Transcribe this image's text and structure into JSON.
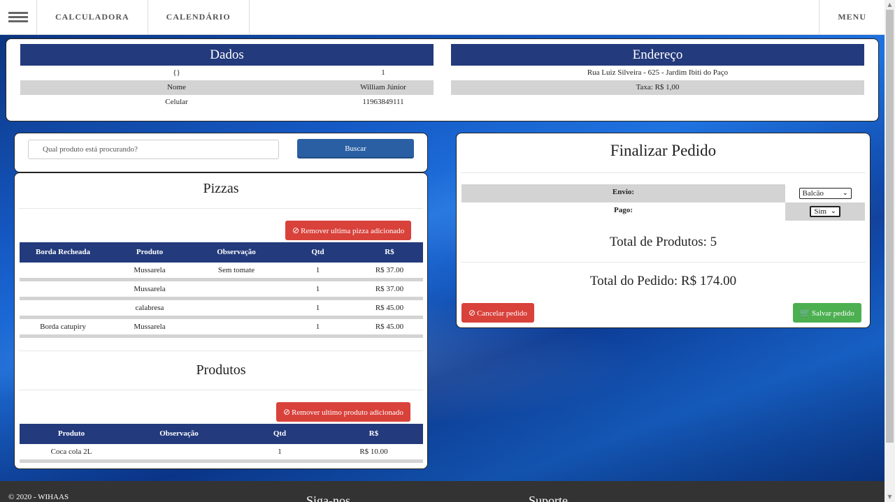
{
  "nav": {
    "links": [
      "CALCULADORA",
      "CALENDÁRIO"
    ],
    "menu": "MENU"
  },
  "dados": {
    "title": "Dados",
    "rows": [
      [
        "{}",
        "1"
      ],
      [
        "Nome",
        "William Júnior"
      ],
      [
        "Celular",
        "11963849111"
      ]
    ]
  },
  "endereco": {
    "title": "Endereço",
    "address": "Rua Luiz Silveira - 625 - Jardim Ibiti do Paço",
    "taxa": "Taxa: R$ 1,00"
  },
  "search": {
    "placeholder": "Qual produto está procurando?",
    "button": "Buscar"
  },
  "pizzas": {
    "title": "Pizzas",
    "remove_button": "Remover ultima pizza adicionado",
    "headers": [
      "Borda Recheada",
      "Produto",
      "Observação",
      "Qtd",
      "R$"
    ],
    "rows": [
      [
        "",
        "Mussarela",
        "Sem tomate",
        "1",
        "R$ 37.00"
      ],
      [
        "",
        "Mussarela",
        "",
        "1",
        "R$ 37.00"
      ],
      [
        "",
        "calabresa",
        "",
        "1",
        "R$ 45.00"
      ],
      [
        "Borda catupiry",
        "Mussarela",
        "",
        "1",
        "R$ 45.00"
      ]
    ]
  },
  "produtos": {
    "title": "Produtos",
    "remove_button": "Remover ultimo produto adicionado",
    "headers": [
      "Produto",
      "Observação",
      "Qtd",
      "R$"
    ],
    "rows": [
      [
        "Coca cola 2L",
        "",
        "1",
        "R$ 10.00"
      ]
    ]
  },
  "finalizar": {
    "title": "Finalizar Pedido",
    "envio_label": "Envio:",
    "envio_value": "Balcão",
    "pago_label": "Pago:",
    "pago_value": "Sim",
    "total_produtos": "Total de Produtos: 5",
    "total_pedido": "Total do Pedido: R$ 174.00",
    "cancel_button": "Cancelar pedido",
    "save_button": "Salvar pedido"
  },
  "footer": {
    "copyright": "© 2020 - WIHAAS",
    "col2": "Siga-nos",
    "col3": "Suporte"
  }
}
